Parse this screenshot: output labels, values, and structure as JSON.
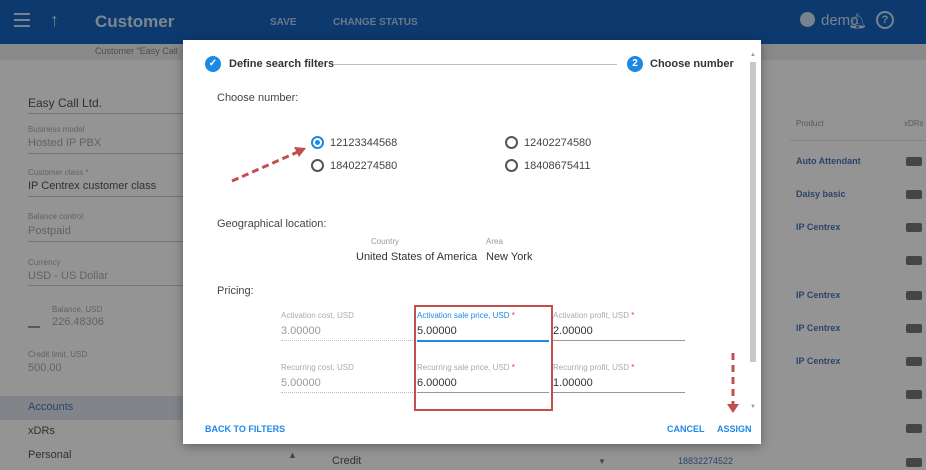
{
  "appbar": {
    "title": "Customer",
    "save_label": "SAVE",
    "change_status_label": "CHANGE STATUS",
    "user_name": "demo",
    "help_glyph": "?"
  },
  "breadcrumb": "Customer \"Easy Call",
  "left_panel": {
    "customer_name": "Easy Call Ltd.",
    "business_model_label": "Business model",
    "business_model_value": "Hosted IP PBX",
    "customer_class_label": "Customer class *",
    "customer_class_value": "IP Centrex customer class",
    "balance_control_label": "Balance control",
    "balance_control_value": "Postpaid",
    "currency_label": "Currency",
    "currency_value": "USD - US Dollar",
    "balance_label": "Balance, USD",
    "balance_value": "226.48306",
    "credit_limit_label": "Credit limit, USD",
    "credit_limit_value": "500.00",
    "nav_items": [
      "Accounts",
      "xDRs",
      "Personal"
    ]
  },
  "right_panel": {
    "product_header": "Product",
    "xdrs_header": "xDRs",
    "products": [
      "Auto Attendant",
      "Daisy basic",
      "IP Centrex",
      "IP Centrex",
      "IP Centrex",
      "IP Centrex"
    ],
    "bottom_phone": "18832274522"
  },
  "background_bottom": {
    "field_value": "Credit"
  },
  "dialog": {
    "step1_label": "Define search filters",
    "step2_number": "2",
    "step2_label": "Choose number",
    "choose_number_label": "Choose number:",
    "numbers": [
      {
        "value": "12123344568",
        "checked": true
      },
      {
        "value": "12402274580",
        "checked": false
      },
      {
        "value": "18402274580",
        "checked": false
      },
      {
        "value": "18408675411",
        "checked": false
      }
    ],
    "geo_label": "Geographical location:",
    "country_label": "Country",
    "country_value": "United States of America",
    "area_label": "Area",
    "area_value": "New York",
    "pricing_label": "Pricing:",
    "pricing": {
      "activation_cost_label": "Activation cost, USD",
      "activation_cost_value": "3.00000",
      "activation_sale_label": "Activation sale price, USD",
      "activation_sale_value": "5.00000",
      "activation_profit_label": "Activation profit, USD",
      "activation_profit_value": "2.00000",
      "recurring_cost_label": "Recurring cost, USD",
      "recurring_cost_value": "5.00000",
      "recurring_sale_label": "Recurring sale price, USD",
      "recurring_sale_value": "6.00000",
      "recurring_profit_label": "Recurring profit, USD",
      "recurring_profit_value": "1.00000",
      "required_mark": "*"
    },
    "back_label": "BACK TO FILTERS",
    "cancel_label": "CANCEL",
    "assign_label": "ASSIGN"
  },
  "colors": {
    "appbar": "#1565c0",
    "accent": "#1e88e5",
    "annotation": "#c0504d"
  },
  "icons": [
    "menu-icon",
    "arrow-up-icon",
    "user-icon",
    "bell-icon",
    "help-icon",
    "check-icon",
    "bank-icon"
  ]
}
